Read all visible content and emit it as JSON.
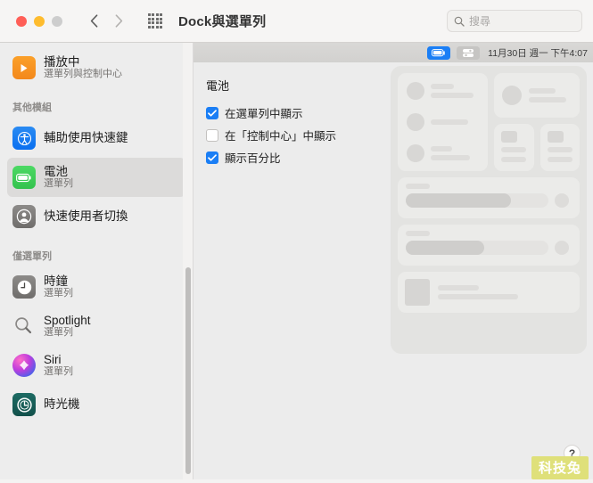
{
  "window": {
    "title": "Dock與選單列",
    "traffic_lights": [
      "close",
      "minimize",
      "zoom"
    ],
    "back_icon": "chevron-left-icon",
    "forward_icon": "chevron-right-icon",
    "grid_icon": "show-all-grid-icon"
  },
  "search": {
    "icon": "search-icon",
    "placeholder": "搜尋",
    "value": ""
  },
  "sidebar": {
    "groups": [
      {
        "header": "",
        "items": [
          {
            "title": "播放中",
            "subtitle": "選單列與控制中心",
            "icon": "now-playing-icon",
            "selected": false
          }
        ]
      },
      {
        "header": "其他模組",
        "items": [
          {
            "title": "輔助使用快速鍵",
            "subtitle": "",
            "icon": "accessibility-icon",
            "selected": false
          },
          {
            "title": "電池",
            "subtitle": "選單列",
            "icon": "battery-icon",
            "selected": true
          },
          {
            "title": "快速使用者切換",
            "subtitle": "",
            "icon": "user-switch-icon",
            "selected": false
          }
        ]
      },
      {
        "header": "僅選單列",
        "items": [
          {
            "title": "時鐘",
            "subtitle": "選單列",
            "icon": "clock-icon",
            "selected": false
          },
          {
            "title": "Spotlight",
            "subtitle": "選單列",
            "icon": "spotlight-icon",
            "selected": false
          },
          {
            "title": "Siri",
            "subtitle": "選單列",
            "icon": "siri-icon",
            "selected": false
          },
          {
            "title": "時光機",
            "subtitle": "",
            "icon": "time-machine-icon",
            "selected": false
          }
        ]
      }
    ]
  },
  "menubar_preview": {
    "battery_icon": "battery-icon",
    "control_center_icon": "control-center-icon",
    "datetime": "11月30日 週一 下午4:07"
  },
  "panel": {
    "title": "電池",
    "checkboxes": [
      {
        "label": "在選單列中顯示",
        "checked": true
      },
      {
        "label": "在「控制中心」中顯示",
        "checked": false
      },
      {
        "label": "顯示百分比",
        "checked": true
      }
    ]
  },
  "help": {
    "label": "?"
  },
  "watermark": {
    "text": "科技兔"
  },
  "colors": {
    "accent": "#1a7ef5",
    "battery_green": "#34c24d",
    "now_playing_orange": "#f3881b",
    "sidebar_bg": "#ededed",
    "content_bg": "#ececec",
    "watermark_bg": "#dfe07a"
  }
}
